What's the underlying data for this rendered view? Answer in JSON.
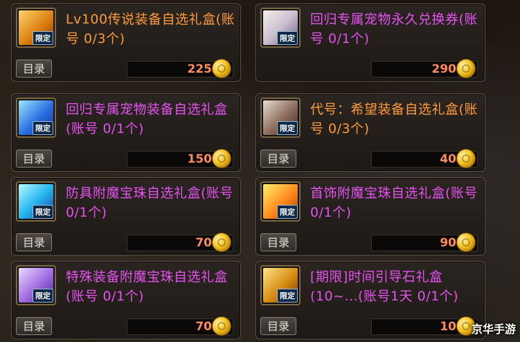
{
  "directory_label": "目录",
  "limited_label": "限定",
  "watermark": "京华手游",
  "items": [
    {
      "title": "Lv100传说装备自选礼盒(账号 0/3个)",
      "price": "225",
      "title_color": "#ff9a3c"
    },
    {
      "title": "回归专属宠物永久兑换券(账号 0/1个)",
      "price": "290",
      "title_color": "#e552f0"
    },
    {
      "title": "回归专属宠物装备自选礼盒(账号 0/1个)",
      "price": "150",
      "title_color": "#e552f0"
    },
    {
      "title": "代号：希望装备自选礼盒(账号 0/3个)",
      "price": "40",
      "title_color": "#ff9a3c"
    },
    {
      "title": "防具附魔宝珠自选礼盒(账号 0/1个)",
      "price": "70",
      "title_color": "#e552f0"
    },
    {
      "title": "首饰附魔宝珠自选礼盒(账号 0/1个)",
      "price": "90",
      "title_color": "#e552f0"
    },
    {
      "title": "特殊装备附魔宝珠自选礼盒(账号 0/1个)",
      "price": "70",
      "title_color": "#e552f0"
    },
    {
      "title": "[期限]时间引导石礼盒(10~...(账号1天 0/1个)",
      "price": "10",
      "title_color": "#e552f0"
    }
  ]
}
